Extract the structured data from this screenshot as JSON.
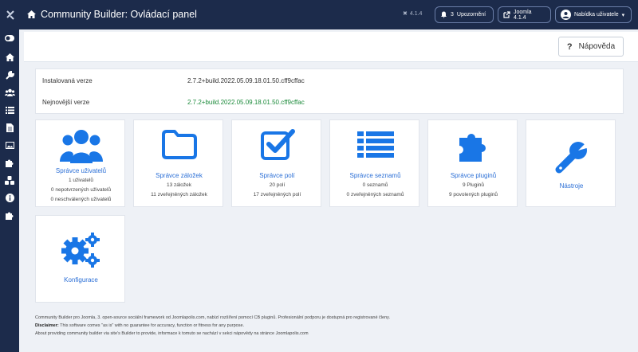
{
  "header": {
    "title": "Community Builder: Ovládací panel",
    "version": "4.1.4",
    "notifications_count": "3",
    "notifications_label": "Upozornění",
    "joomla_label": "Joomla 4.1.4",
    "user_menu_label": "Nabídka uživatele"
  },
  "toolbar": {
    "help_label": "Nápověda"
  },
  "info": {
    "installed_label": "Instalovaná verze",
    "installed_value": "2.7.2+build.2022.05.09.18.01.50.cff9cffac",
    "latest_label": "Nejnovější verze",
    "latest_value": "2.7.2+build.2022.05.09.18.01.50.cff9cffac"
  },
  "cards": [
    {
      "title": "Správce uživatelů",
      "lines": [
        "1 uživatelů",
        "0 nepotvrzených uživatelů",
        "0 neschválených uživatelů"
      ]
    },
    {
      "title": "Správce záložek",
      "lines": [
        "13 záložek",
        "11 zveřejněných záložek"
      ]
    },
    {
      "title": "Správce polí",
      "lines": [
        "20 polí",
        "17 zveřejněných polí"
      ]
    },
    {
      "title": "Správce seznamů",
      "lines": [
        "0 seznamů",
        "0 zveřejněných seznamů"
      ]
    },
    {
      "title": "Správce pluginů",
      "lines": [
        "9 Pluginů",
        "9 povolených pluginů"
      ]
    },
    {
      "title": "Nástroje",
      "lines": []
    },
    {
      "title": "Konfigurace",
      "lines": []
    }
  ],
  "footer": {
    "line1": "Community Builder pro Joomla, 3. open-source sociální framework od Joomlapolis.com, nabízí rozšíření pomocí CB pluginů. Profesionální podporu je dostupná pro registrované členy.",
    "disclaimer_label": "Disclaimer:",
    "disclaimer_text": "This software comes \"as is\" with no guarantee for accuracy, function or fitness for any purpose.",
    "line3": "About providing community builder via site's Builder to provide, informace k tomuto se nachází v sekci nápovědy na stránce Joomlapolis.com"
  },
  "colors": {
    "accent": "#2b6fd6",
    "icon_blue": "#1976e6",
    "header_bg": "#1c2b4b",
    "latest_green": "#1b8a3a"
  }
}
